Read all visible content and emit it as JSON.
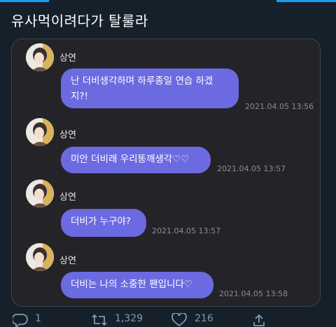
{
  "tweet": {
    "text": "유사먹이려다가 탈룰라"
  },
  "chat": {
    "messages": [
      {
        "sender": "상연",
        "text_line1": "난 더비생각하며 하루종일 연습 하겠",
        "text_line2": "지?!",
        "time": "2021.04.05 13:56"
      },
      {
        "sender": "상연",
        "text": "미안 더비래 우리똥깨생각♡♡",
        "time": "2021.04.05 13:57"
      },
      {
        "sender": "상연",
        "text": "더비가 누구야?",
        "time": "2021.04.05 13:57"
      },
      {
        "sender": "상연",
        "text": "더비는 나의 소중한 팬입니다♡",
        "time": "2021.04.05 13:58"
      }
    ]
  },
  "actions": {
    "reply_count": "1",
    "retweet_count": "1,329",
    "like_count": "216"
  },
  "colors": {
    "background": "#15202b",
    "bubble": "#6c6ae0",
    "accent": "#1d9bf0"
  }
}
